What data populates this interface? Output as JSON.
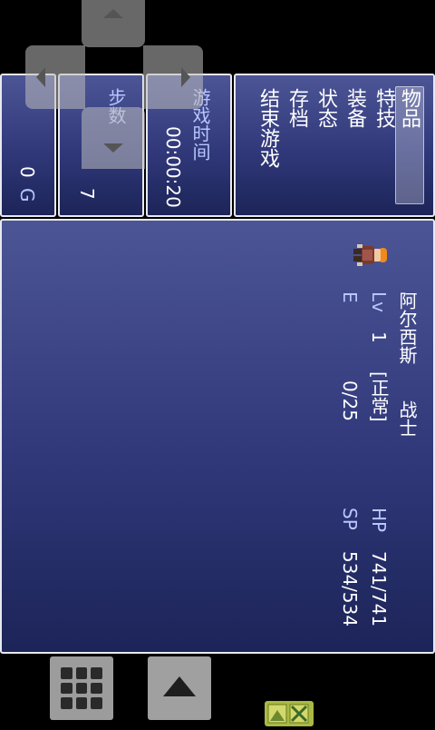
{
  "menu": {
    "items": [
      "物品",
      "特技",
      "装备",
      "状态",
      "存档",
      "结束游戏"
    ],
    "selected_index": 0
  },
  "playtime": {
    "label": "游戏时间",
    "value": "00:00:20"
  },
  "steps": {
    "label": "步数",
    "value": "7"
  },
  "gold": {
    "value": "0",
    "unit": "G"
  },
  "party": [
    {
      "name": "阿尔西斯",
      "class": "战士",
      "level_label": "Lv",
      "level": "1",
      "state": "[正常]",
      "exp_label": "E",
      "exp": "0/25",
      "hp_label": "HP",
      "hp": "741/741",
      "sp_label": "SP",
      "sp": "534/534"
    }
  ],
  "controls": {
    "dpad": [
      "dpad-up",
      "dpad-left",
      "dpad-right",
      "dpad-down"
    ],
    "menu_button_icon": "grid-icon",
    "up_button_icon": "up-arrow-icon"
  }
}
